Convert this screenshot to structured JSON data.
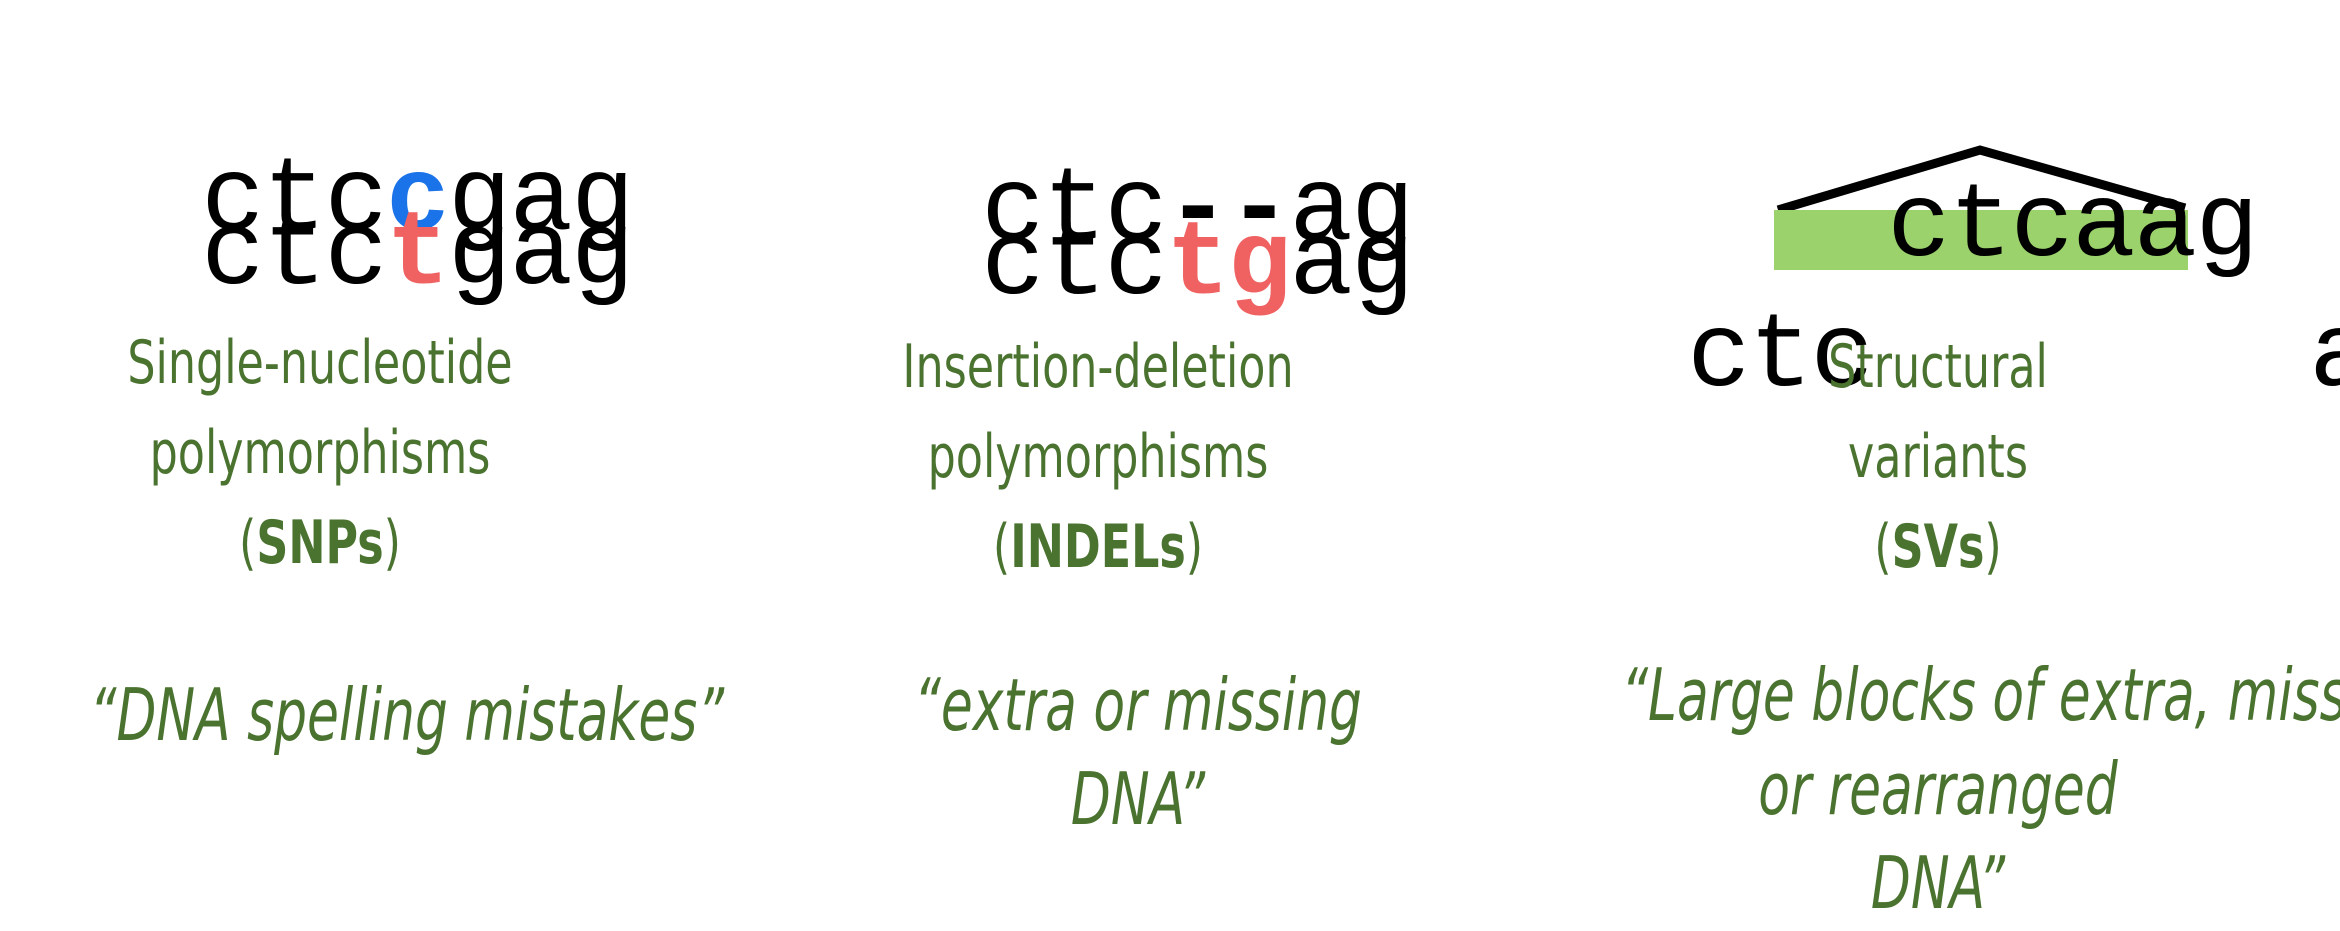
{
  "colors": {
    "blue": "#1a73e8",
    "red": "#f06262",
    "green_text": "#4a7330",
    "green_block": "#9bd26c",
    "black": "#000000"
  },
  "snp": {
    "ref": {
      "pre": "ctc",
      "var": "c",
      "post": "gag"
    },
    "alt": {
      "pre": "ctc",
      "var": "t",
      "post": "gag"
    },
    "label": {
      "line1": "Single-nucleotide",
      "line2": "polymorphisms",
      "open": "(",
      "abbr": "SNPs",
      "close": ")"
    },
    "quote": {
      "line1": "“DNA spelling mistakes”"
    }
  },
  "indel": {
    "ref": {
      "pre": "ctc",
      "var": "--",
      "post": "ag"
    },
    "alt": {
      "pre": "ctc",
      "var": "tg",
      "post": "ag"
    },
    "label": {
      "line1": "Insertion-deletion",
      "line2": "polymorphisms",
      "open": "(",
      "abbr": "INDELs",
      "close": ")"
    },
    "quote": {
      "line1": "“extra or missing",
      "line2": "DNA”"
    }
  },
  "sv": {
    "inserted": "ctcaag",
    "left": "ctc",
    "right": "ag",
    "label": {
      "line1": "Structural",
      "line2": "variants",
      "open": "(",
      "abbr": "SVs",
      "close": ")"
    },
    "quote": {
      "line1": "“Large blocks of extra, missing",
      "line2": "or rearranged",
      "line3": "DNA”"
    }
  }
}
